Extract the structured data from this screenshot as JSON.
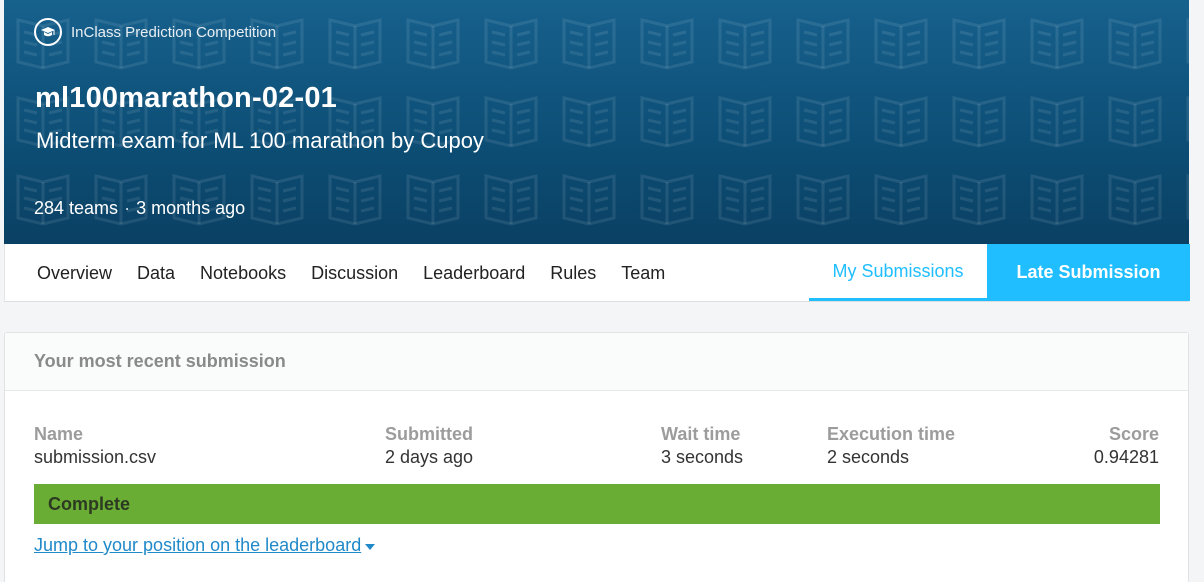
{
  "competition": {
    "type_label": "InClass Prediction Competition",
    "title": "ml100marathon-02-01",
    "subtitle": "Midterm exam for ML 100 marathon by Cupoy",
    "teams": "284 teams",
    "separator": "·",
    "age": "3 months ago",
    "colors": {
      "banner": "#0d4f77",
      "accent": "#20beff"
    }
  },
  "nav": {
    "tabs": [
      "Overview",
      "Data",
      "Notebooks",
      "Discussion",
      "Leaderboard",
      "Rules",
      "Team"
    ],
    "my_submissions": "My Submissions",
    "late_submission": "Late Submission"
  },
  "submission": {
    "header": "Your most recent submission",
    "columns": {
      "name": {
        "label": "Name",
        "value": "submission.csv"
      },
      "submitted": {
        "label": "Submitted",
        "value": "2 days ago"
      },
      "wait": {
        "label": "Wait time",
        "value": "3 seconds"
      },
      "exec": {
        "label": "Execution time",
        "value": "2 seconds"
      },
      "score": {
        "label": "Score",
        "value": "0.94281"
      }
    },
    "status": "Complete",
    "status_color": "#6aad35",
    "jump_link": "Jump to your position on the leaderboard"
  }
}
